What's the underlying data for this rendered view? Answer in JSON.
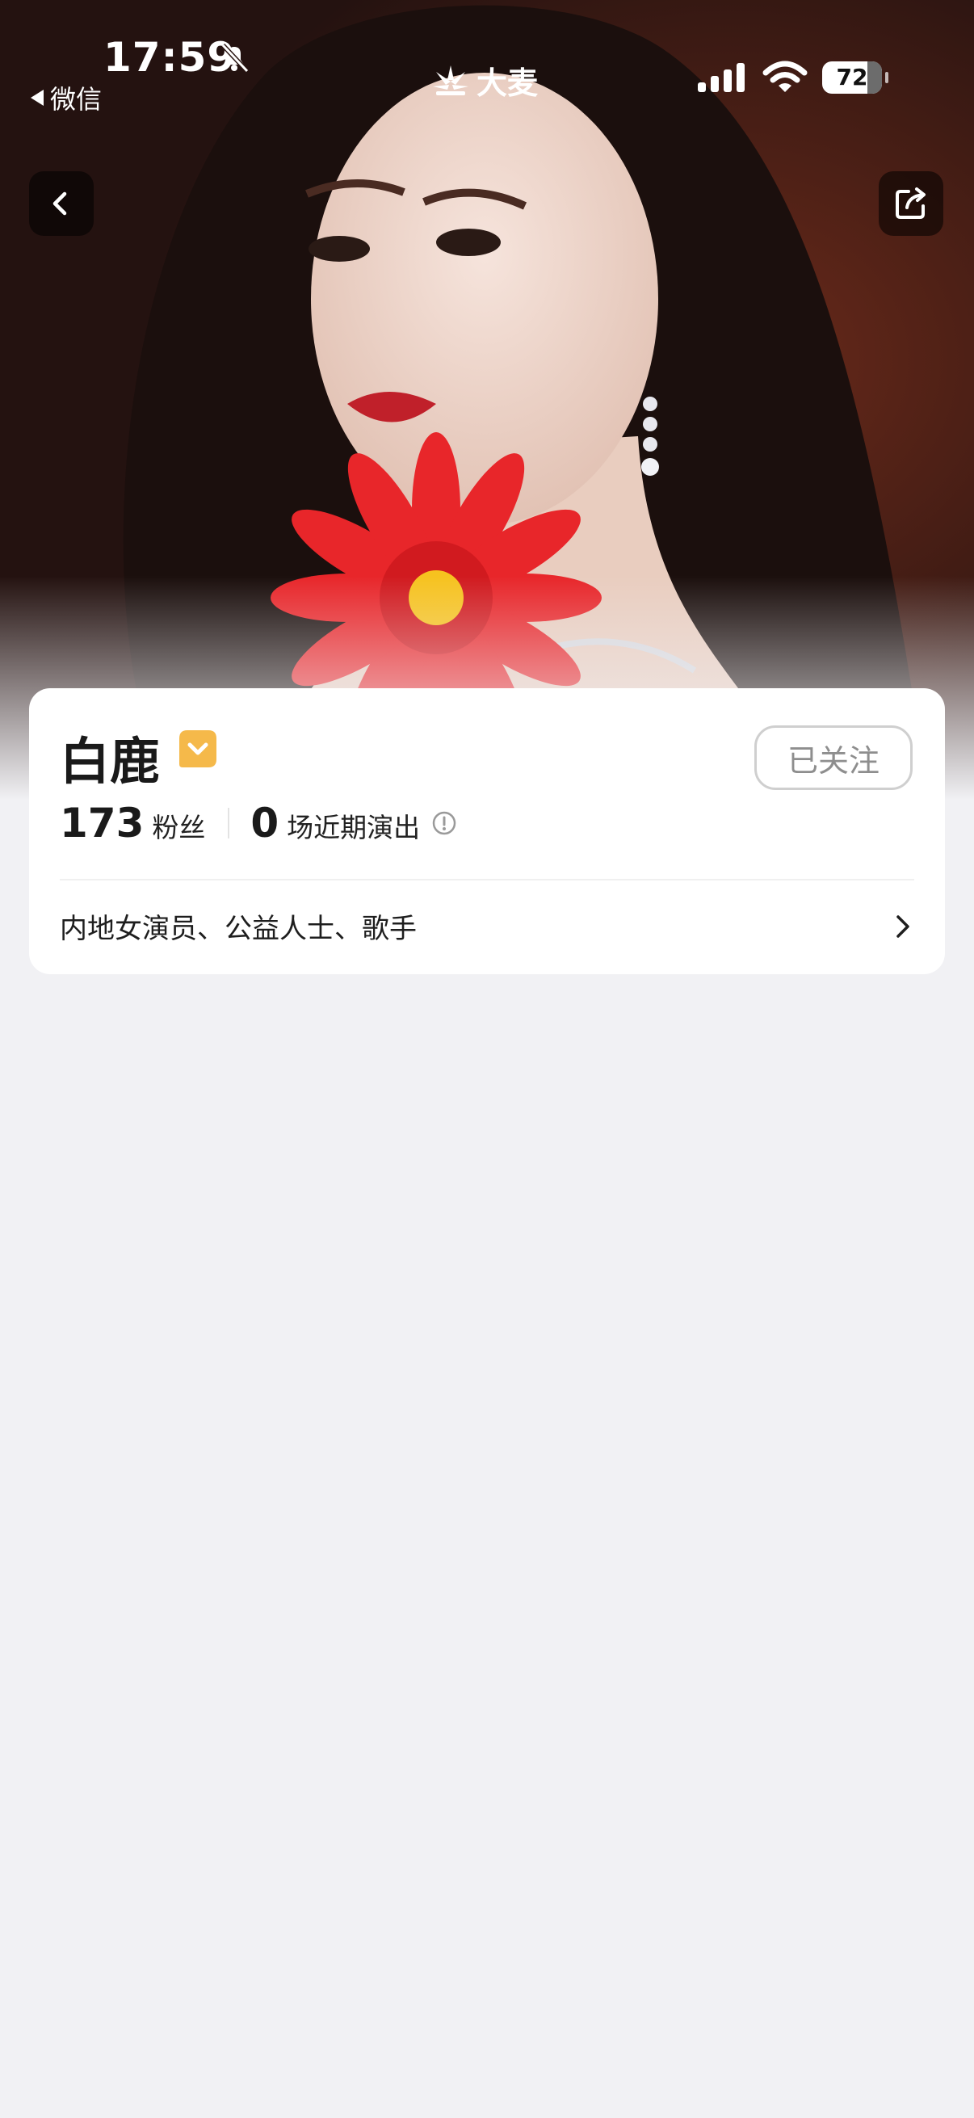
{
  "status_bar": {
    "time": "17:59",
    "back_app": "微信",
    "brand": "大麦",
    "battery": "72"
  },
  "artist": {
    "name": "白鹿",
    "follow_label": "已关注",
    "followers_count": "173",
    "followers_label": "粉丝",
    "shows_count": "0",
    "shows_label": "场近期演出",
    "description": "内地女演员、公益人士、歌手"
  },
  "colors": {
    "page_bg": "#f1f1f4",
    "verified_badge": "#f5b94a",
    "follow_border": "#cfcfcf"
  },
  "icons": [
    "bell-slash-icon",
    "signal-icon",
    "wifi-icon",
    "battery-icon",
    "back-chevron-icon",
    "share-icon",
    "verified-icon",
    "info-icon",
    "chevron-right-icon"
  ]
}
